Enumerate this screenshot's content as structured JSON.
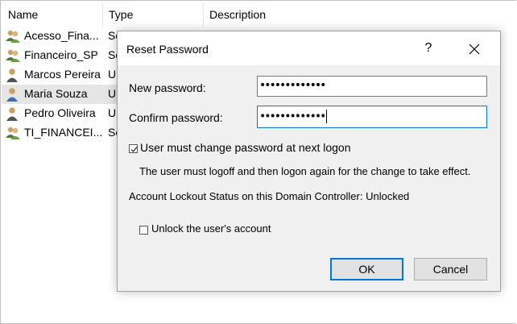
{
  "list": {
    "columns": [
      "Name",
      "Type",
      "Description"
    ],
    "rows": [
      {
        "name": "Acesso_Fina...",
        "type": "Se"
      },
      {
        "name": "Financeiro_SP",
        "type": "Se"
      },
      {
        "name": "Marcos Pereira",
        "type": "U"
      },
      {
        "name": "Maria Souza",
        "type": "U"
      },
      {
        "name": "Pedro Oliveira",
        "type": "U"
      },
      {
        "name": "TI_FINANCEI...",
        "type": "Se"
      }
    ]
  },
  "dialog": {
    "title": "Reset Password",
    "help_label": "?",
    "new_password_label": "New password:",
    "new_password_value": "•••••••••••••",
    "confirm_password_label": "Confirm password:",
    "confirm_password_value": "•••••••••••••",
    "must_change_label": "User must change password at next logon",
    "must_change_checked": true,
    "info_text": "The user must logoff and then logon again for the change to take effect.",
    "lockout_status": "Account Lockout Status on this Domain Controller: Unlocked",
    "unlock_label": "Unlock the user's account",
    "unlock_checked": false,
    "ok_label": "OK",
    "cancel_label": "Cancel"
  },
  "icons": {
    "group": "group-icon",
    "user": "user-icon",
    "close": "close-icon"
  },
  "colors": {
    "focus_border": "#0078d7",
    "selection": "#e5e5e5",
    "dialog_bg": "#f0f0f0"
  }
}
